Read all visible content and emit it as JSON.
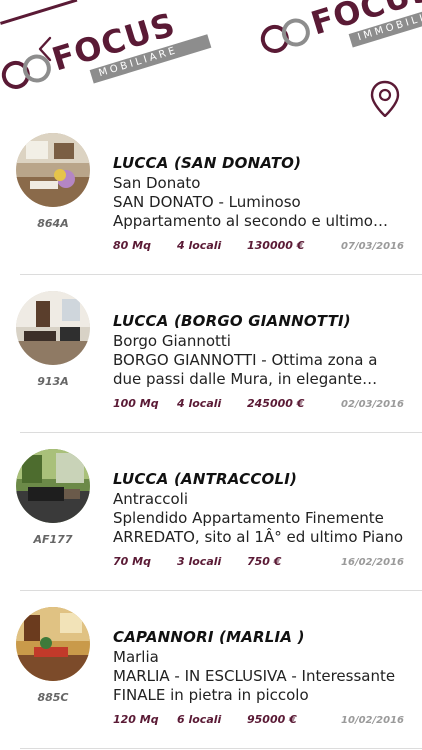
{
  "header": {
    "logo_word": "FOCUS",
    "logo_band": "IMMOBILIARE",
    "logo_band_partial": "MOBILIARE",
    "brand_color": "#5a1a35",
    "band_color": "#8d8d8d"
  },
  "listings": [
    {
      "code": "864A",
      "title": "LUCCA (SAN DONATO)",
      "subtitle": "San Donato",
      "description": "SAN DONATO - Luminoso Appartamento al secondo e ultimo piano",
      "size": "80 Mq",
      "rooms": "4 locali",
      "price": "130000 €",
      "date": "07/03/2016"
    },
    {
      "code": "913A",
      "title": "LUCCA (BORGO GIANNOTTI)",
      "subtitle": "Borgo Giannotti",
      "description": "BORGO GIANNOTTI - Ottima zona a due passi dalle Mura, in elegante complesso",
      "size": "100 Mq",
      "rooms": "4 locali",
      "price": "245000 €",
      "date": "02/03/2016"
    },
    {
      "code": "AF177",
      "title": "LUCCA (ANTRACCOLI)",
      "subtitle": "Antraccoli",
      "description": "Splendido Appartamento Finemente ARREDATO, sito al 1Â° ed ultimo Piano",
      "size": "70 Mq",
      "rooms": "3 locali",
      "price": "750 €",
      "date": "16/02/2016"
    },
    {
      "code": "885C",
      "title": "CAPANNORI (MARLIA )",
      "subtitle": "Marlia",
      "description": "MARLIA - IN ESCLUSIVA - Interessante FINALE in pietra in piccolo",
      "size": "120 Mq",
      "rooms": "6 locali",
      "price": "95000 €",
      "date": "10/02/2016"
    }
  ]
}
